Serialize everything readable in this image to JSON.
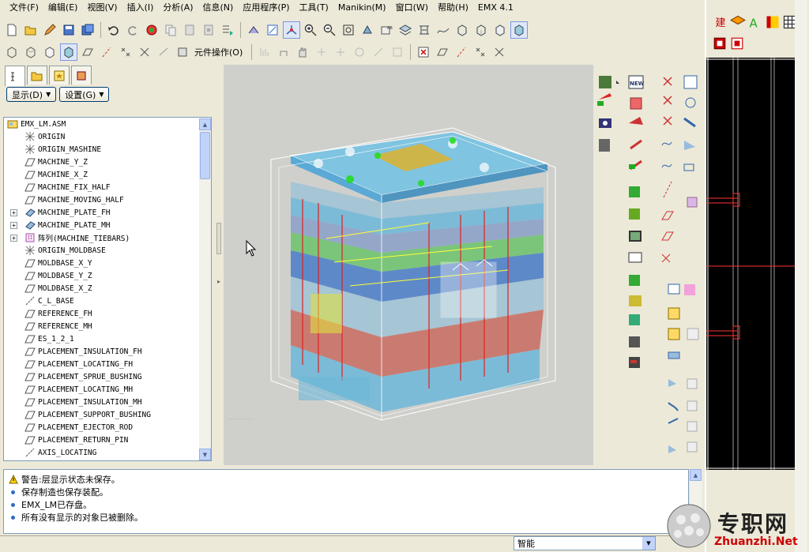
{
  "menu": [
    "文件(F)",
    "编辑(E)",
    "视图(V)",
    "插入(I)",
    "分析(A)",
    "信息(N)",
    "应用程序(P)",
    "工具(T)",
    "Manikin(M)",
    "窗口(W)",
    "帮助(H)",
    "EMX 4.1"
  ],
  "toolbar2": {
    "component_ops_label": "元件操作(O)"
  },
  "nav": {
    "show_btn": "显示(D)",
    "settings_btn": "设置(G)",
    "tree": [
      {
        "label": "EMX_LM.ASM",
        "icon": "assembly-icon",
        "expand": ""
      },
      {
        "label": "ORIGIN",
        "icon": "csys-icon",
        "expand": ""
      },
      {
        "label": "ORIGIN_MASHINE",
        "icon": "csys-icon",
        "expand": ""
      },
      {
        "label": "MACHINE_Y_Z",
        "icon": "datum-plane-icon",
        "expand": ""
      },
      {
        "label": "MACHINE_X_Z",
        "icon": "datum-plane-icon",
        "expand": ""
      },
      {
        "label": "MACHINE_FIX_HALF",
        "icon": "datum-plane-icon",
        "expand": ""
      },
      {
        "label": "MACHINE_MOVING_HALF",
        "icon": "datum-plane-icon",
        "expand": ""
      },
      {
        "label": "MACHINE_PLATE_FH",
        "icon": "part-icon",
        "expand": "+"
      },
      {
        "label": "MACHINE_PLATE_MH",
        "icon": "part-icon",
        "expand": "+"
      },
      {
        "label": "阵列(MACHINE_TIEBARS)",
        "icon": "pattern-icon",
        "expand": "+"
      },
      {
        "label": "ORIGIN_MOLDBASE",
        "icon": "csys-icon",
        "expand": ""
      },
      {
        "label": "MOLDBASE_X_Y",
        "icon": "datum-plane-icon",
        "expand": ""
      },
      {
        "label": "MOLDBASE_Y_Z",
        "icon": "datum-plane-icon",
        "expand": ""
      },
      {
        "label": "MOLDBASE_X_Z",
        "icon": "datum-plane-icon",
        "expand": ""
      },
      {
        "label": "C_L_BASE",
        "icon": "datum-axis-icon",
        "expand": ""
      },
      {
        "label": "REFERENCE_FH",
        "icon": "datum-plane-icon",
        "expand": ""
      },
      {
        "label": "REFERENCE_MH",
        "icon": "datum-plane-icon",
        "expand": ""
      },
      {
        "label": "ES_1_2_1",
        "icon": "datum-plane-icon",
        "expand": ""
      },
      {
        "label": "PLACEMENT_INSULATION_FH",
        "icon": "datum-plane-icon",
        "expand": ""
      },
      {
        "label": "PLACEMENT_LOCATING_FH",
        "icon": "datum-plane-icon",
        "expand": ""
      },
      {
        "label": "PLACEMENT_SPRUE_BUSHING",
        "icon": "datum-plane-icon",
        "expand": ""
      },
      {
        "label": "PLACEMENT_LOCATING_MH",
        "icon": "datum-plane-icon",
        "expand": ""
      },
      {
        "label": "PLACEMENT_INSULATION_MH",
        "icon": "datum-plane-icon",
        "expand": ""
      },
      {
        "label": "PLACEMENT_SUPPORT_BUSHING",
        "icon": "datum-plane-icon",
        "expand": ""
      },
      {
        "label": "PLACEMENT_EJECTOR_ROD",
        "icon": "datum-plane-icon",
        "expand": ""
      },
      {
        "label": "PLACEMENT_RETURN_PIN",
        "icon": "datum-plane-icon",
        "expand": ""
      },
      {
        "label": "AXIS_LOCATING",
        "icon": "datum-axis-icon",
        "expand": ""
      }
    ]
  },
  "messages": [
    {
      "type": "warning",
      "text": "警告:层显示状态未保存。"
    },
    {
      "type": "info",
      "text": "保存制造也保存装配。"
    },
    {
      "type": "info",
      "text": "EMX_LM已存盘。"
    },
    {
      "type": "info",
      "text": "所有没有显示的对象已被删除。"
    }
  ],
  "status": {
    "filter_value": "智能"
  },
  "sidewin": {
    "tab_label": "建"
  },
  "watermark": {
    "brand": "专职网",
    "url": "Zhuanzhi.Net"
  },
  "colors": {
    "bg": "#ece9d8",
    "tree_border": "#7f9db9",
    "model_blue": "#5aa9d6",
    "model_green": "#6cc36c",
    "model_red": "#c0504d"
  }
}
